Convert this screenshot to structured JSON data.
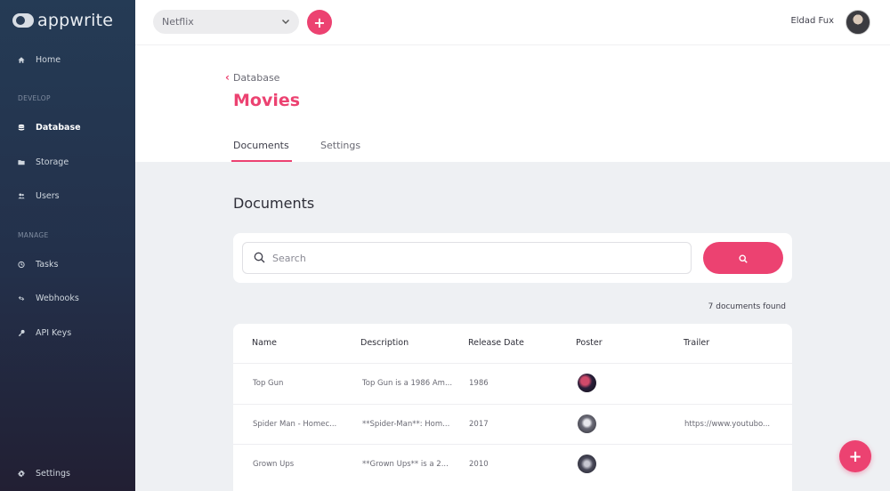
{
  "brand": {
    "name": "appwrite"
  },
  "sidebar": {
    "home": "Home",
    "develop_label": "DEVELOP",
    "database": "Database",
    "storage": "Storage",
    "users": "Users",
    "manage_label": "MANAGE",
    "tasks": "Tasks",
    "webhooks": "Webhooks",
    "api_keys": "API Keys",
    "settings": "Settings"
  },
  "topbar": {
    "project": "Netflix",
    "user_name": "Eldad Fux"
  },
  "header": {
    "breadcrumb": "Database",
    "title": "Movies",
    "tabs": [
      {
        "label": "Documents"
      },
      {
        "label": "Settings"
      }
    ]
  },
  "main": {
    "section_title": "Documents",
    "search_placeholder": "Search",
    "count_text": "7 documents found",
    "columns": [
      "Name",
      "Description",
      "Release Date",
      "Poster",
      "Trailer"
    ],
    "rows": [
      {
        "name": "Top Gun",
        "description": "Top Gun is a 1986 Am...",
        "release": "1986",
        "trailer": ""
      },
      {
        "name": "Spider Man - Homec...",
        "description": "**Spider-Man**: Hom...",
        "release": "2017",
        "trailer": "https://www.youtubo..."
      },
      {
        "name": "Grown Ups",
        "description": "**Grown Ups** is a 2...",
        "release": "2010",
        "trailer": ""
      }
    ]
  },
  "colors": {
    "accent": "#ec4271",
    "sidebar": "#253b55"
  },
  "icons": {
    "home": "home-icon",
    "database": "database-icon",
    "storage": "folder-icon",
    "users": "users-icon",
    "tasks": "clock-icon",
    "webhooks": "link-icon",
    "api_keys": "key-icon",
    "settings": "gear-icon"
  }
}
